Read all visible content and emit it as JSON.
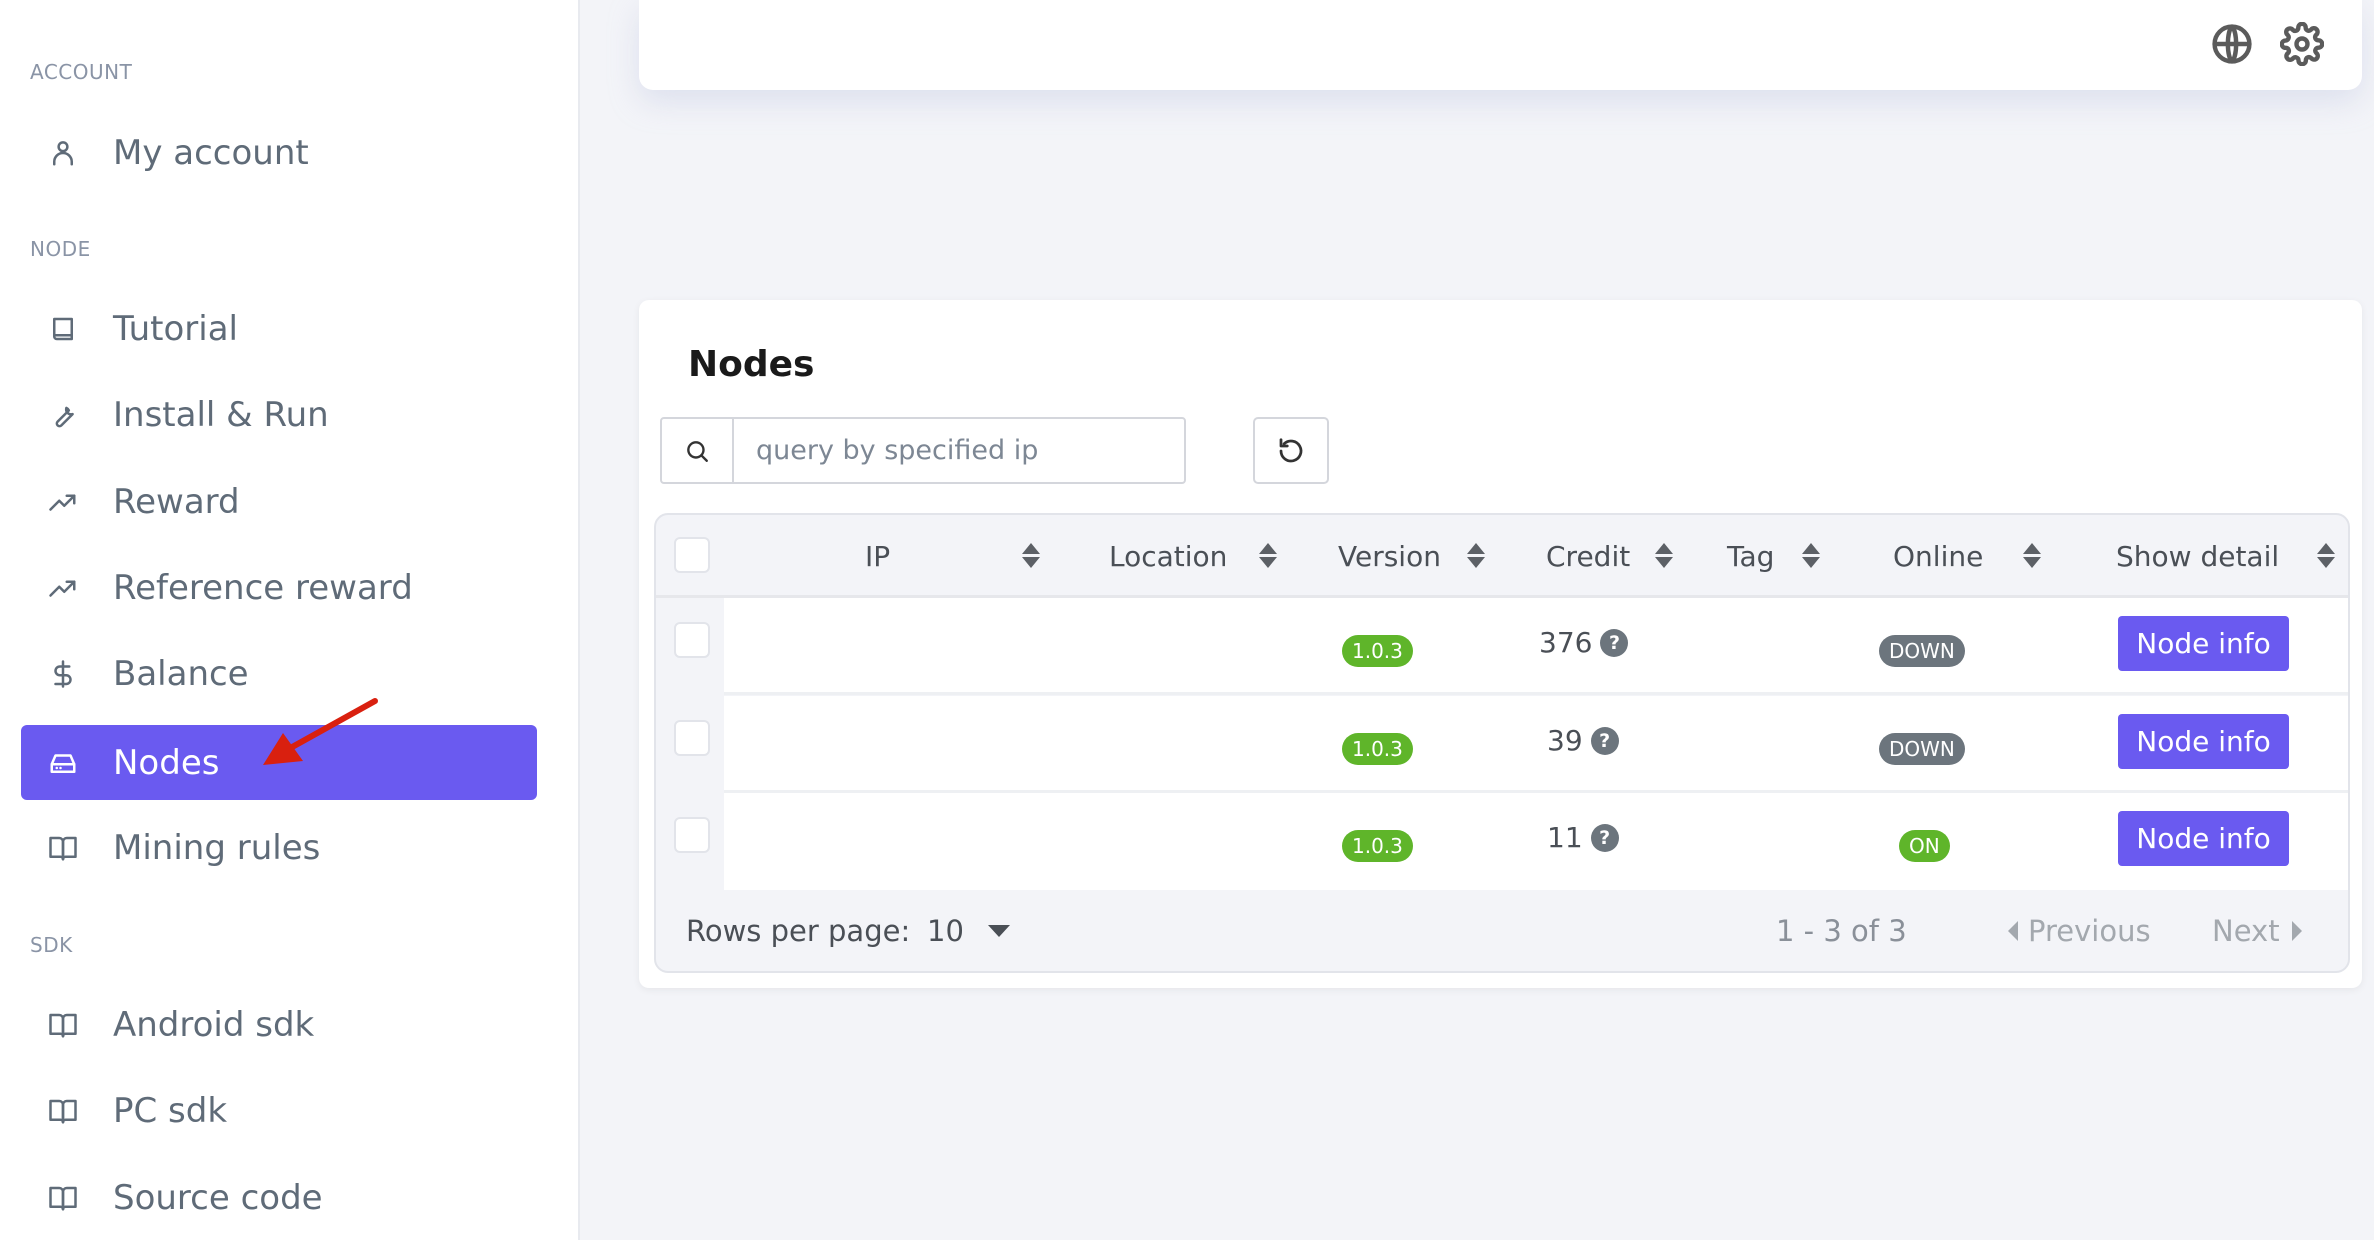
{
  "sidebar": {
    "sections": [
      {
        "label": "ACCOUNT"
      },
      {
        "label": "NODE"
      },
      {
        "label": "SDK"
      }
    ],
    "items": [
      {
        "label": "My account",
        "icon": "user-icon"
      },
      {
        "label": "Tutorial",
        "icon": "book-icon"
      },
      {
        "label": "Install & Run",
        "icon": "wrench-icon"
      },
      {
        "label": "Reward",
        "icon": "trending-up-icon"
      },
      {
        "label": "Reference reward",
        "icon": "trending-up-icon"
      },
      {
        "label": "Balance",
        "icon": "dollar-icon"
      },
      {
        "label": "Nodes",
        "icon": "hard-drive-icon",
        "active": true
      },
      {
        "label": "Mining rules",
        "icon": "book-open-icon"
      },
      {
        "label": "Android sdk",
        "icon": "book-open-icon"
      },
      {
        "label": "PC sdk",
        "icon": "book-open-icon"
      },
      {
        "label": "Source code",
        "icon": "book-open-icon"
      }
    ],
    "active_color": "#6a5af0"
  },
  "topbar": {
    "icons": [
      "globe-icon",
      "gear-icon"
    ]
  },
  "nodes": {
    "title": "Nodes",
    "search": {
      "placeholder": "query by specified ip",
      "value": ""
    },
    "columns": [
      "IP",
      "Location",
      "Version",
      "Credit",
      "Tag",
      "Online",
      "Show detail"
    ],
    "rows": [
      {
        "ip": "",
        "location": "",
        "version": "1.0.3",
        "credit": "376",
        "tag": "",
        "online": "DOWN",
        "action": "Node info"
      },
      {
        "ip": "",
        "location": "",
        "version": "1.0.3",
        "credit": "39",
        "tag": "",
        "online": "DOWN",
        "action": "Node info"
      },
      {
        "ip": "",
        "location": "",
        "version": "1.0.3",
        "credit": "11",
        "tag": "",
        "online": "ON",
        "action": "Node info"
      }
    ],
    "footer": {
      "rows_per_page_label": "Rows per page:",
      "rows_per_page": "10",
      "range": "1 - 3 of 3",
      "previous": "Previous",
      "next": "Next"
    },
    "colors": {
      "version_badge": "#5fb52a",
      "on_badge": "#5fb52a",
      "down_badge": "#6c757d",
      "button": "#6a5af0"
    }
  }
}
